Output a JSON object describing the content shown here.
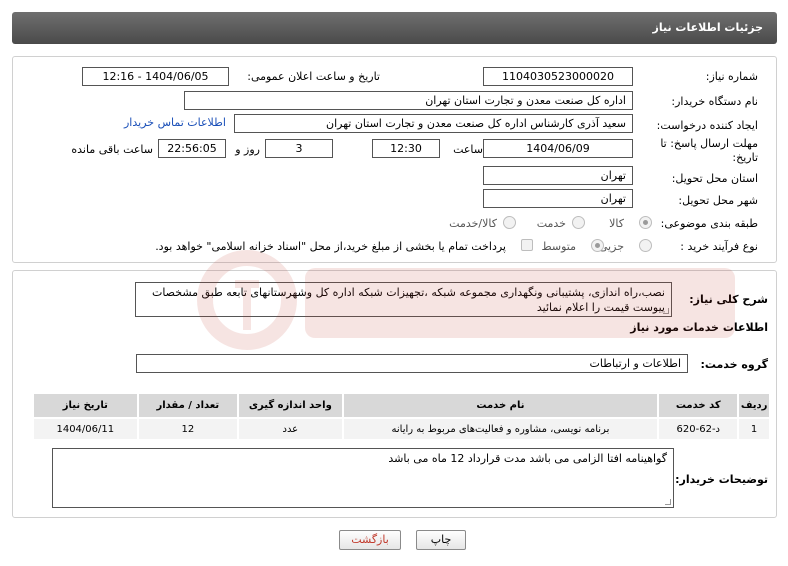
{
  "header": {
    "title": "جزئیات اطلاعات نیاز"
  },
  "fields": {
    "need_number_label": "شماره نیاز:",
    "need_number": "1104030523000020",
    "announce_label": "تاریخ و ساعت اعلان عمومی:",
    "announce_value": "1404/06/05 - 12:16",
    "buyer_org_label": "نام دستگاه خریدار:",
    "buyer_org": "اداره کل صنعت  معدن و تجارت استان تهران",
    "creator_label": "ایجاد کننده درخواست:",
    "creator": "سعید آذری کارشناس اداره کل صنعت  معدن و تجارت استان تهران",
    "buyer_contact_link": "اطلاعات تماس خریدار",
    "deadline_label_1": "مهلت ارسال پاسخ: تا",
    "deadline_label_2": "تاریخ:",
    "deadline_date": "1404/06/09",
    "time_label": "ساعت",
    "deadline_time": "12:30",
    "days_value": "3",
    "days_label": "روز و",
    "remaining_time": "22:56:05",
    "remaining_label": "ساعت باقی مانده",
    "delivery_province_label": "استان محل تحویل:",
    "delivery_province": "تهران",
    "delivery_city_label": "شهر محل تحویل:",
    "delivery_city": "تهران",
    "category_label": "طبقه بندی موضوعی:",
    "category_options": [
      "کالا",
      "خدمت",
      "کالا/خدمت"
    ],
    "process_label": "نوع فرآیند خرید :",
    "process_options": [
      "جزیی",
      "متوسط"
    ],
    "payment_note": "پرداخت تمام یا بخشی از مبلغ خرید،از محل \"اسناد خزانه اسلامی\" خواهد بود."
  },
  "summary": {
    "label": "شرح کلی نیاز:",
    "text": "نصب،راه اندازی، پشتیبانی ونگهداری مجموعه شبکه ،تجهیزات شبکه اداره کل وشهرستانهای تابعه طبق مشخصات پیوست قیمت را اعلام نمائید"
  },
  "services": {
    "section_title": "اطلاعات خدمات مورد نیاز",
    "group_label": "گروه خدمت:",
    "group_value": "اطلاعات و ارتباطات",
    "columns": [
      "ردیف",
      "کد خدمت",
      "نام خدمت",
      "واحد اندازه گیری",
      "تعداد / مقدار",
      "تاریخ نیاز"
    ],
    "rows": [
      [
        "1",
        "د-62-620",
        "برنامه نویسی، مشاوره و فعالیت‌های مربوط به رایانه",
        "عدد",
        "12",
        "1404/06/11"
      ]
    ]
  },
  "buyer_notes": {
    "label": "توضیحات خریدار:",
    "text": "گواهینامه افتا الزامی می باشد مدت قرارداد 12 ماه می باشد"
  },
  "buttons": {
    "print": "چاپ",
    "back": "بازگشت"
  },
  "colors": {
    "header_bg": "#5a5a5a",
    "link": "#1a4fb8",
    "back_text": "#c0392b"
  }
}
